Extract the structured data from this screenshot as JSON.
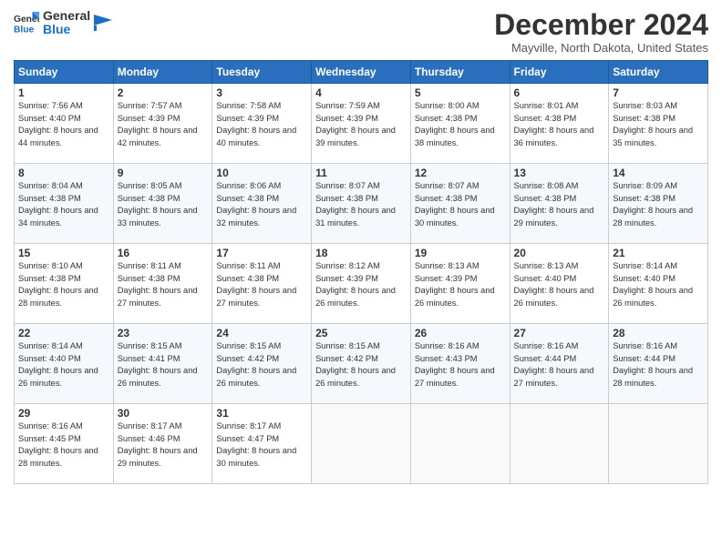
{
  "logo": {
    "line1": "General",
    "line2": "Blue"
  },
  "title": "December 2024",
  "location": "Mayville, North Dakota, United States",
  "headers": [
    "Sunday",
    "Monday",
    "Tuesday",
    "Wednesday",
    "Thursday",
    "Friday",
    "Saturday"
  ],
  "rows": [
    [
      {
        "day": "1",
        "rise": "7:56 AM",
        "set": "4:40 PM",
        "daylight": "8 hours and 44 minutes."
      },
      {
        "day": "2",
        "rise": "7:57 AM",
        "set": "4:39 PM",
        "daylight": "8 hours and 42 minutes."
      },
      {
        "day": "3",
        "rise": "7:58 AM",
        "set": "4:39 PM",
        "daylight": "8 hours and 40 minutes."
      },
      {
        "day": "4",
        "rise": "7:59 AM",
        "set": "4:39 PM",
        "daylight": "8 hours and 39 minutes."
      },
      {
        "day": "5",
        "rise": "8:00 AM",
        "set": "4:38 PM",
        "daylight": "8 hours and 38 minutes."
      },
      {
        "day": "6",
        "rise": "8:01 AM",
        "set": "4:38 PM",
        "daylight": "8 hours and 36 minutes."
      },
      {
        "day": "7",
        "rise": "8:03 AM",
        "set": "4:38 PM",
        "daylight": "8 hours and 35 minutes."
      }
    ],
    [
      {
        "day": "8",
        "rise": "8:04 AM",
        "set": "4:38 PM",
        "daylight": "8 hours and 34 minutes."
      },
      {
        "day": "9",
        "rise": "8:05 AM",
        "set": "4:38 PM",
        "daylight": "8 hours and 33 minutes."
      },
      {
        "day": "10",
        "rise": "8:06 AM",
        "set": "4:38 PM",
        "daylight": "8 hours and 32 minutes."
      },
      {
        "day": "11",
        "rise": "8:07 AM",
        "set": "4:38 PM",
        "daylight": "8 hours and 31 minutes."
      },
      {
        "day": "12",
        "rise": "8:07 AM",
        "set": "4:38 PM",
        "daylight": "8 hours and 30 minutes."
      },
      {
        "day": "13",
        "rise": "8:08 AM",
        "set": "4:38 PM",
        "daylight": "8 hours and 29 minutes."
      },
      {
        "day": "14",
        "rise": "8:09 AM",
        "set": "4:38 PM",
        "daylight": "8 hours and 28 minutes."
      }
    ],
    [
      {
        "day": "15",
        "rise": "8:10 AM",
        "set": "4:38 PM",
        "daylight": "8 hours and 28 minutes."
      },
      {
        "day": "16",
        "rise": "8:11 AM",
        "set": "4:38 PM",
        "daylight": "8 hours and 27 minutes."
      },
      {
        "day": "17",
        "rise": "8:11 AM",
        "set": "4:38 PM",
        "daylight": "8 hours and 27 minutes."
      },
      {
        "day": "18",
        "rise": "8:12 AM",
        "set": "4:39 PM",
        "daylight": "8 hours and 26 minutes."
      },
      {
        "day": "19",
        "rise": "8:13 AM",
        "set": "4:39 PM",
        "daylight": "8 hours and 26 minutes."
      },
      {
        "day": "20",
        "rise": "8:13 AM",
        "set": "4:40 PM",
        "daylight": "8 hours and 26 minutes."
      },
      {
        "day": "21",
        "rise": "8:14 AM",
        "set": "4:40 PM",
        "daylight": "8 hours and 26 minutes."
      }
    ],
    [
      {
        "day": "22",
        "rise": "8:14 AM",
        "set": "4:40 PM",
        "daylight": "8 hours and 26 minutes."
      },
      {
        "day": "23",
        "rise": "8:15 AM",
        "set": "4:41 PM",
        "daylight": "8 hours and 26 minutes."
      },
      {
        "day": "24",
        "rise": "8:15 AM",
        "set": "4:42 PM",
        "daylight": "8 hours and 26 minutes."
      },
      {
        "day": "25",
        "rise": "8:15 AM",
        "set": "4:42 PM",
        "daylight": "8 hours and 26 minutes."
      },
      {
        "day": "26",
        "rise": "8:16 AM",
        "set": "4:43 PM",
        "daylight": "8 hours and 27 minutes."
      },
      {
        "day": "27",
        "rise": "8:16 AM",
        "set": "4:44 PM",
        "daylight": "8 hours and 27 minutes."
      },
      {
        "day": "28",
        "rise": "8:16 AM",
        "set": "4:44 PM",
        "daylight": "8 hours and 28 minutes."
      }
    ],
    [
      {
        "day": "29",
        "rise": "8:16 AM",
        "set": "4:45 PM",
        "daylight": "8 hours and 28 minutes."
      },
      {
        "day": "30",
        "rise": "8:17 AM",
        "set": "4:46 PM",
        "daylight": "8 hours and 29 minutes."
      },
      {
        "day": "31",
        "rise": "8:17 AM",
        "set": "4:47 PM",
        "daylight": "8 hours and 30 minutes."
      },
      null,
      null,
      null,
      null
    ]
  ]
}
